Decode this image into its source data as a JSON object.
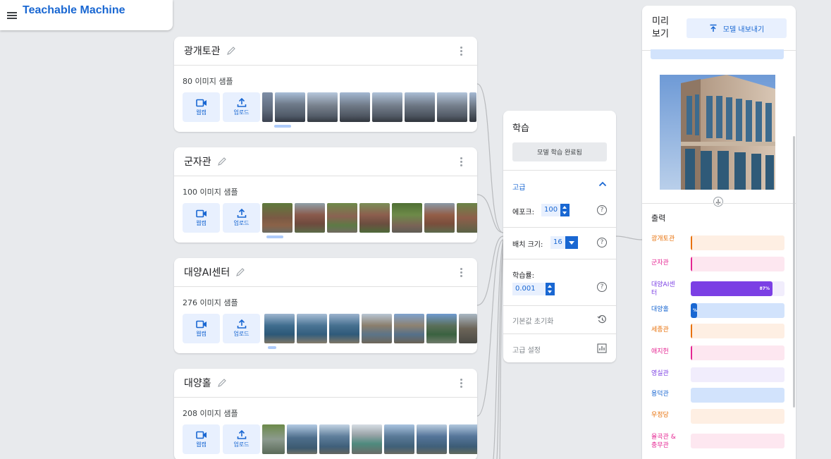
{
  "app": {
    "title": "Teachable Machine"
  },
  "classes": [
    {
      "name": "광개토관",
      "count": "80",
      "count_suffix": " 이미지 샘플",
      "webcam": "웹캠",
      "upload": "업로드"
    },
    {
      "name": "군자관",
      "count": "100",
      "count_suffix": " 이미지 샘플",
      "webcam": "웹캠",
      "upload": "업로드"
    },
    {
      "name": "대양AI센터",
      "count": "276",
      "count_suffix": " 이미지 샘플",
      "webcam": "웹캠",
      "upload": "업로드"
    },
    {
      "name": "대양홀",
      "count": "208",
      "count_suffix": " 이미지 샘플",
      "webcam": "웹캠",
      "upload": "업로드"
    }
  ],
  "training": {
    "title": "학습",
    "button": "모델 학습 완료됨",
    "advanced": "고급",
    "epochs_label": "에포크:",
    "epochs_value": "100",
    "batch_label": "배치 크기:",
    "batch_value": "16",
    "lr_label": "학습률:",
    "lr_value": "0.001",
    "reset": "기본값 초기화",
    "advanced_settings": "고급 설정"
  },
  "preview": {
    "title": "미리 보기",
    "export": "모델 내보내기",
    "output_label": "출력",
    "outputs": [
      {
        "name": "광개토관",
        "color": "#e8710a",
        "bg": "#feefe3",
        "value": 0.01,
        "label": ""
      },
      {
        "name": "군자관",
        "color": "#e52592",
        "bg": "#fde7f0",
        "value": 0.005,
        "label": ""
      },
      {
        "name": "대양AI센터",
        "color": "#7b3fe4",
        "bg": "#f1edfc",
        "value": 0.87,
        "label": "87%"
      },
      {
        "name": "대양홀",
        "color": "#1967d2",
        "bg": "#d2e3fc",
        "value": 0.07,
        "label": "%"
      },
      {
        "name": "세종관",
        "color": "#e8710a",
        "bg": "#feefe3",
        "value": 0.01,
        "label": ""
      },
      {
        "name": "애지헌",
        "color": "#e52592",
        "bg": "#fde7f0",
        "value": 0.005,
        "label": ""
      },
      {
        "name": "영실관",
        "color": "#7b3fe4",
        "bg": "#f1edfc",
        "value": 0,
        "label": ""
      },
      {
        "name": "용덕관",
        "color": "#1967d2",
        "bg": "#d2e3fc",
        "value": 0,
        "label": ""
      },
      {
        "name": "우정당",
        "color": "#e8710a",
        "bg": "#feefe3",
        "value": 0,
        "label": ""
      },
      {
        "name": "율곡관 & 충무관",
        "color": "#e52592",
        "bg": "#fde7f0",
        "value": 0,
        "label": ""
      }
    ]
  },
  "colors": {
    "accent": "#1967d2",
    "background": "#e8eaed"
  }
}
